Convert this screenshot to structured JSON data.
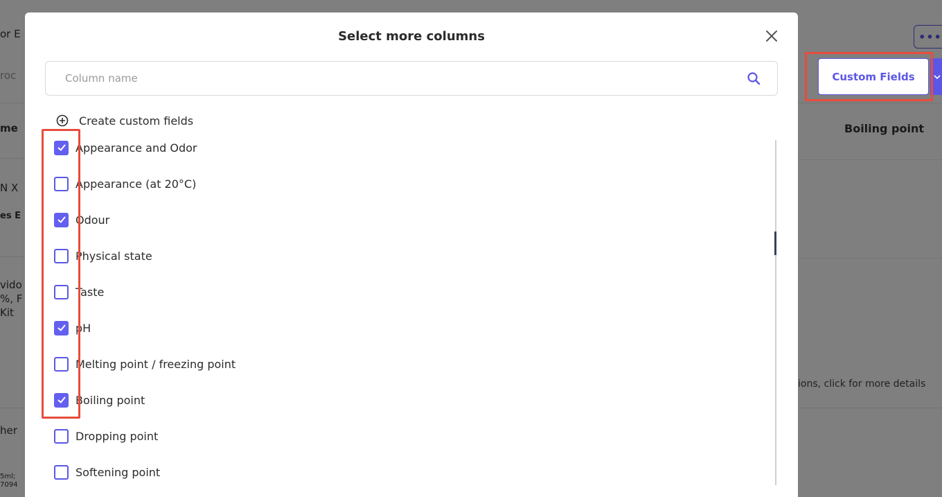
{
  "background": {
    "more_button_label": "•••",
    "custom_fields_button_label": "Custom Fields",
    "custom_fields_dropdown_icon": "chevron-down-icon",
    "column_header": "Boiling point",
    "more_details_text": "ions, click for more details",
    "left_fragments": [
      {
        "text": "or E",
        "style": "normal"
      },
      {
        "text": "roc",
        "style": "faint"
      },
      {
        "text": "me",
        "style": "bold"
      },
      {
        "text": "N X",
        "style": "normal"
      },
      {
        "text": "es E",
        "style": "bold"
      },
      {
        "text": "vido",
        "style": "normal"
      },
      {
        "text": "%, F",
        "style": "normal"
      },
      {
        "text": "Kit",
        "style": "normal"
      },
      {
        "text": "her",
        "style": "normal"
      },
      {
        "text": "5ml;",
        "style": "small"
      },
      {
        "text": "7094",
        "style": "small"
      }
    ]
  },
  "modal": {
    "title": "Select more columns",
    "close_icon": "close-icon",
    "search": {
      "placeholder": "Column name",
      "value": "",
      "icon": "search-icon"
    },
    "create_label": "Create custom fields",
    "create_icon": "plus-circle-icon",
    "items": [
      {
        "label": "Appearance and Odor",
        "checked": true
      },
      {
        "label": "Appearance (at 20°C)",
        "checked": false
      },
      {
        "label": "Odour",
        "checked": true
      },
      {
        "label": "Physical state",
        "checked": false
      },
      {
        "label": "Taste",
        "checked": false
      },
      {
        "label": "pH",
        "checked": true
      },
      {
        "label": "Melting point / freezing point",
        "checked": false
      },
      {
        "label": "Boiling point",
        "checked": true
      },
      {
        "label": "Dropping point",
        "checked": false
      },
      {
        "label": "Softening point",
        "checked": false
      }
    ]
  },
  "colors": {
    "accent": "#5b57e6",
    "checkbox_checked": "#6360f0",
    "highlight": "#e74c3c"
  }
}
